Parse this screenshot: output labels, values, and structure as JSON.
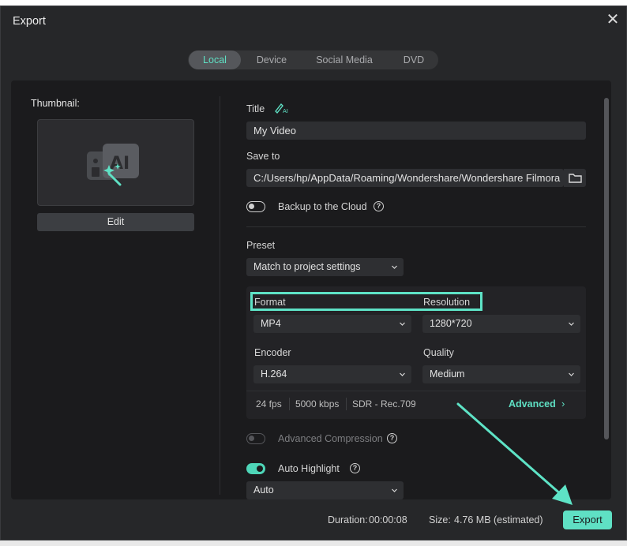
{
  "window": {
    "title": "Export"
  },
  "tabs": [
    {
      "label": "Local",
      "active": true
    },
    {
      "label": "Device",
      "active": false
    },
    {
      "label": "Social Media",
      "active": false
    },
    {
      "label": "DVD",
      "active": false
    }
  ],
  "thumbnail": {
    "label": "Thumbnail:",
    "edit_label": "Edit",
    "icon": "ai-image-icon"
  },
  "title_field": {
    "label": "Title",
    "ai_badge": "AI",
    "value": "My Video"
  },
  "save_to": {
    "label": "Save to",
    "value": "C:/Users/hp/AppData/Roaming/Wondershare/Wondershare Filmora"
  },
  "backup": {
    "label": "Backup to the Cloud",
    "enabled": false
  },
  "preset": {
    "label": "Preset",
    "value": "Match to project settings"
  },
  "format": {
    "label": "Format",
    "value": "MP4"
  },
  "resolution": {
    "label": "Resolution",
    "value": "1280*720"
  },
  "encoder": {
    "label": "Encoder",
    "value": "H.264"
  },
  "quality": {
    "label": "Quality",
    "value": "Medium"
  },
  "stats": {
    "fps": "24 fps",
    "bitrate": "5000 kbps",
    "color": "SDR - Rec.709"
  },
  "advanced_label": "Advanced",
  "advanced_compression": {
    "label": "Advanced Compression",
    "enabled": false
  },
  "auto_highlight": {
    "label": "Auto Highlight",
    "enabled": true,
    "value": "Auto"
  },
  "footer": {
    "duration_label": "Duration:",
    "duration_value": "00:00:08",
    "size_label": "Size:",
    "size_value": "4.76 MB (estimated)",
    "export_label": "Export"
  },
  "colors": {
    "accent": "#5fe0c4",
    "background": "#262729",
    "panel": "#1b1b1d"
  }
}
